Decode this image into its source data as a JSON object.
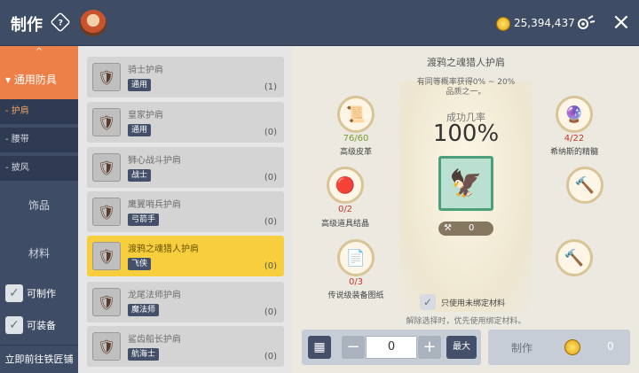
{
  "header": {
    "title": "制作",
    "title_icon": "?",
    "currency": "25,394,437",
    "settings_icon": "gear-link-icon",
    "close_icon": "×"
  },
  "sidebar": {
    "up": "^",
    "active_category": "▾ 通用防具",
    "sub_items": [
      {
        "label": "- 护肩",
        "active": true
      },
      {
        "label": "- 腰带",
        "active": false
      },
      {
        "label": "- 披风",
        "active": false
      }
    ],
    "categories": [
      "饰品",
      "材料"
    ],
    "filters": [
      {
        "label": "可制作",
        "checked": true
      },
      {
        "label": "可装备",
        "checked": true
      }
    ],
    "goto": "立即前往铁匠铺",
    "accent": "#ed7f48"
  },
  "list": {
    "items": [
      {
        "name": "骑士护肩",
        "tag": "通用",
        "count": "(1)",
        "selected": false
      },
      {
        "name": "皇家护肩",
        "tag": "通用",
        "count": "(0)",
        "selected": false
      },
      {
        "name": "狮心战斗护肩",
        "tag": "战士",
        "count": "(0)",
        "selected": false
      },
      {
        "name": "鹰翼哨兵护肩",
        "tag": "弓箭手",
        "count": "(0)",
        "selected": false
      },
      {
        "name": "渡鸦之魂猎人护肩",
        "tag": "飞侠",
        "count": "(0)",
        "selected": true
      },
      {
        "name": "龙尾法师护肩",
        "tag": "魔法师",
        "count": "(0)",
        "selected": false
      },
      {
        "name": "鲨齿船长护肩",
        "tag": "航海士",
        "count": "(0)",
        "selected": false
      }
    ],
    "selected_color": "#f7cf3e"
  },
  "detail": {
    "title": "渡鸦之魂猎人护肩",
    "chance_line1": "有同等概率获得0% ~ 20%",
    "chance_line2": "品质之一。",
    "rate_label": "成功几率",
    "rate": "100%",
    "center_count": "0",
    "materials_left": [
      {
        "count": "76/60",
        "name": "高级皮革",
        "count_color": "#7a9a2e"
      },
      {
        "count": "0/2",
        "name": "高级道具结晶",
        "count_color": "#c0392b"
      },
      {
        "count": "0/3",
        "name": "传说级装备图纸",
        "count_color": "#c0392b"
      }
    ],
    "materials_right": [
      {
        "count": "4/22",
        "name": "希纳斯的精髓",
        "count_color": "#c0392b"
      }
    ],
    "bind_label": "只使用未绑定材料",
    "bind_hint": "解除选择时，优先使用绑定材料。"
  },
  "controls": {
    "quantity": "0",
    "minus": "−",
    "plus": "+",
    "max": "最大",
    "craft": "制作",
    "cost": "0"
  }
}
